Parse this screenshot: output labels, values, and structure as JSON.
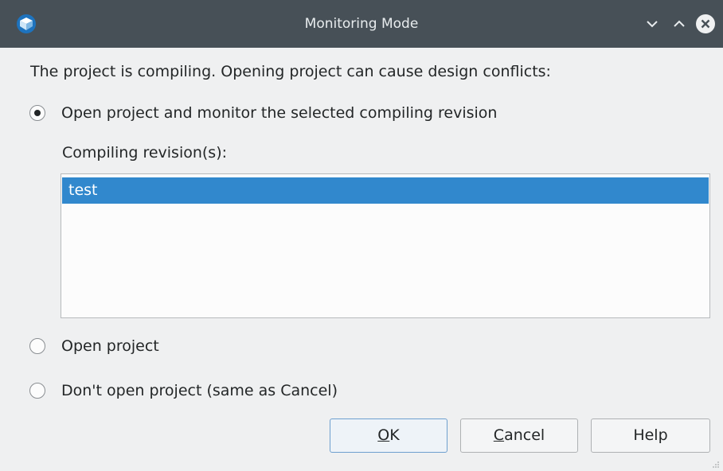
{
  "window": {
    "title": "Monitoring Mode"
  },
  "titlebar_buttons": {
    "minimize_icon": "chevron-down-icon",
    "maximize_icon": "chevron-up-icon",
    "close_icon": "close-icon"
  },
  "dialog": {
    "prompt": "The project is compiling. Opening project can cause design conflicts:",
    "options": [
      {
        "label": "Open project and monitor the selected compiling revision",
        "checked": true
      },
      {
        "label": "Open project",
        "checked": false
      },
      {
        "label": "Don't open project (same as Cancel)",
        "checked": false
      }
    ],
    "revisions_label": "Compiling revision(s):",
    "revisions": [
      {
        "name": "test",
        "selected": true
      }
    ]
  },
  "buttons": {
    "ok_mnemonic": "O",
    "ok_rest": "K",
    "cancel_mnemonic": "C",
    "cancel_rest": "ancel",
    "help": "Help"
  },
  "colors": {
    "titlebar_bg": "#475057",
    "window_bg": "#eff0f1",
    "selection": "#3188cd"
  }
}
